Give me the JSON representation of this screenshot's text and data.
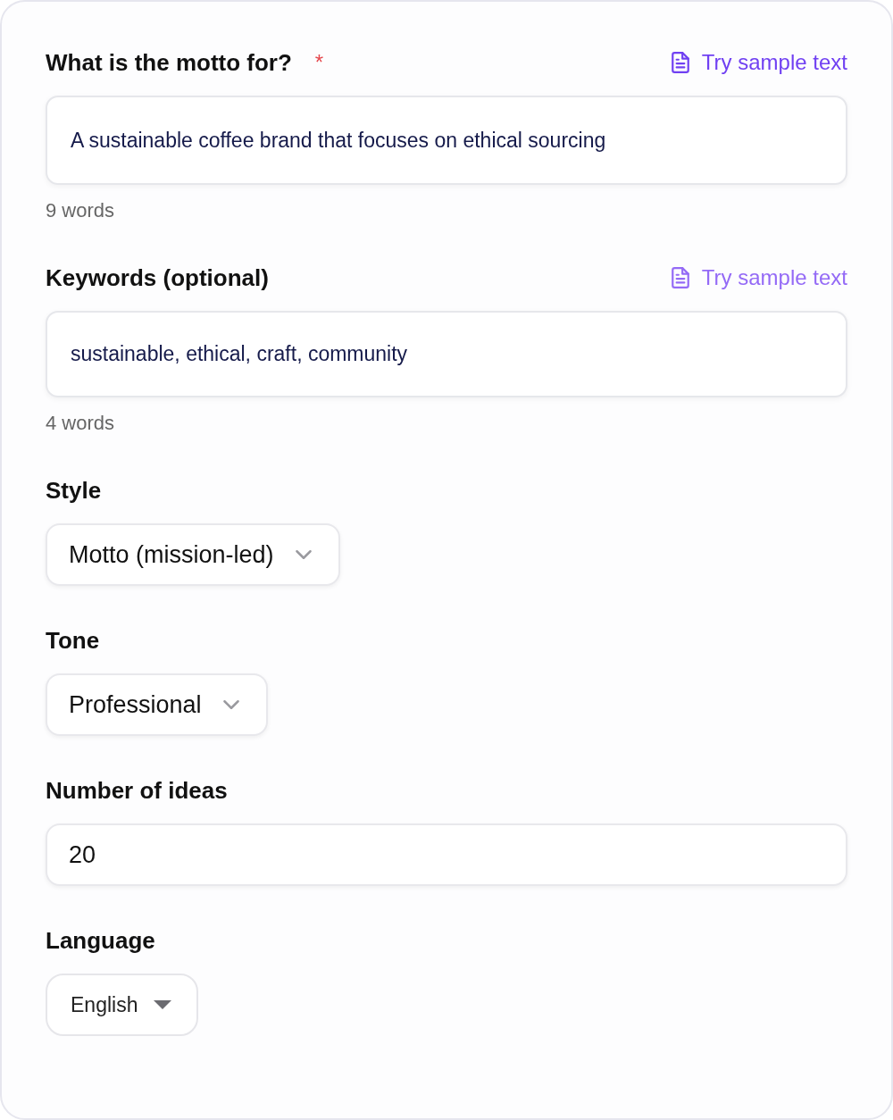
{
  "fields": [
    {
      "kind": "textarea",
      "label": "What is the motto for?",
      "required_mark": "*",
      "sample_link": {
        "label": "Try sample text",
        "color": "#7040f2"
      },
      "value": "A sustainable coffee brand that focuses on ethical sourcing",
      "word_count": "9 words"
    },
    {
      "kind": "textarea",
      "label": "Keywords (optional)",
      "sample_link": {
        "label": "Try sample text",
        "color": "#946af6"
      },
      "value": "sustainable, ethical, craft, community",
      "word_count": "4 words"
    },
    {
      "kind": "select",
      "label": "Style",
      "value": "Motto (mission-led)"
    },
    {
      "kind": "select",
      "label": "Tone",
      "value": "Professional"
    },
    {
      "kind": "number",
      "label": "Number of ideas",
      "value": "20"
    },
    {
      "kind": "native_select",
      "label": "Language",
      "value": "English"
    }
  ]
}
